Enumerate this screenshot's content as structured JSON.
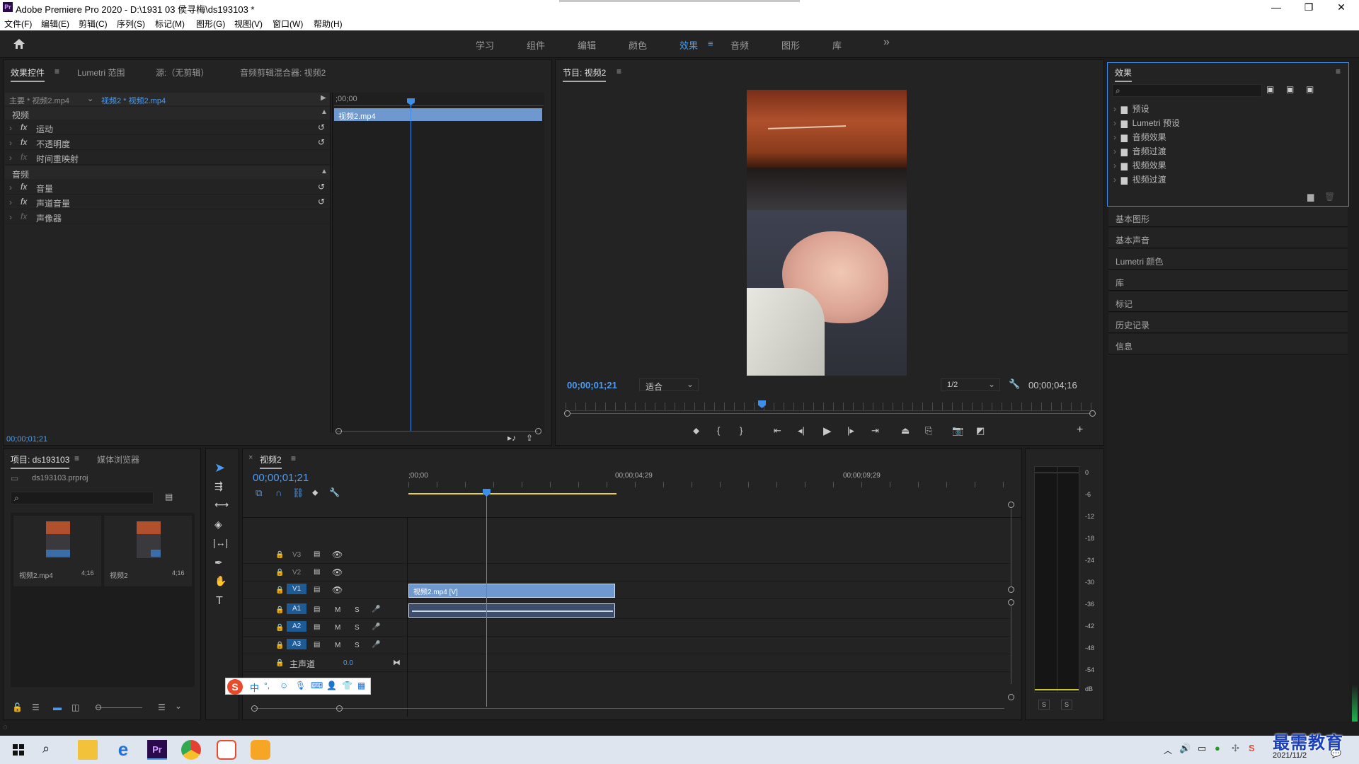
{
  "window": {
    "title": "Adobe Premiere Pro 2020 - D:\\1931 03 侯寻梅\\ds193103 *",
    "logo": "Pr"
  },
  "menu": [
    "文件(F)",
    "编辑(E)",
    "剪辑(C)",
    "序列(S)",
    "标记(M)",
    "图形(G)",
    "视图(V)",
    "窗口(W)",
    "帮助(H)"
  ],
  "workspaces": [
    "学习",
    "组件",
    "编辑",
    "颜色",
    "效果",
    "音频",
    "图形",
    "库"
  ],
  "active_workspace": "效果",
  "effect_controls": {
    "tabs": [
      "效果控件",
      "Lumetri 范围",
      "源:（无剪辑）",
      "音频剪辑混合器: 视频2"
    ],
    "master_label": "主要 * 视频2.mp4",
    "clip_label": "视频2 * 视频2.mp4",
    "timecode_ruler": ";00;00",
    "clip_bar_label": "视频2.mp4",
    "section_video": "视频",
    "video_effects": [
      "运动",
      "不透明度",
      "时间重映射"
    ],
    "section_audio": "音频",
    "audio_effects": [
      "音量",
      "声道音量",
      "声像器"
    ],
    "fx_label": "fx",
    "current_time": "00;00;01;21"
  },
  "program": {
    "title": "节目: 视频2",
    "timecode": "00;00;01;21",
    "fit": "适合",
    "resolution": "1/2",
    "duration": "00;00;04;16"
  },
  "effects_panel": {
    "title": "效果",
    "folders": [
      "预设",
      "Lumetri 预设",
      "音频效果",
      "音频过渡",
      "视频效果",
      "视频过渡"
    ],
    "collapsed_panels": [
      "基本图形",
      "基本声音",
      "Lumetri 颜色",
      "库",
      "标记",
      "历史记录",
      "信息"
    ]
  },
  "project": {
    "tabs": [
      "项目: ds193103",
      "媒体浏览器"
    ],
    "file": "ds193103.prproj",
    "items": [
      {
        "name": "视频2.mp4",
        "duration": "4;16"
      },
      {
        "name": "视频2",
        "duration": "4;16"
      }
    ]
  },
  "timeline": {
    "title": "视频2",
    "timecode": "00;00;01;21",
    "ruler": [
      ";00;00",
      "00;00;04;29",
      "00;00;09;29"
    ],
    "video_tracks": [
      "V3",
      "V2",
      "V1"
    ],
    "audio_tracks": [
      "A1",
      "A2",
      "A3"
    ],
    "track_buttons": {
      "mute": "M",
      "solo": "S"
    },
    "master_label": "主声道",
    "master_value": "0.0",
    "clip_video_label": "视频2.mp4 [V]"
  },
  "meters": {
    "scale": [
      "0",
      "-6",
      "-12",
      "-18",
      "-24",
      "-30",
      "-36",
      "-42",
      "-48",
      "-54",
      "dB"
    ],
    "solo_buttons": [
      "S",
      "S"
    ]
  },
  "ime_toolbar": {
    "label": "中"
  },
  "taskbar": {
    "date": "2021/11/2"
  },
  "watermark": "最需教育",
  "colors": {
    "accent": "#4d9bf0",
    "clip": "#6f98cf",
    "panel": "#232323",
    "bg": "#1d1d1d",
    "playhead": "#3b8eea",
    "workarea": "#e8d43a"
  }
}
